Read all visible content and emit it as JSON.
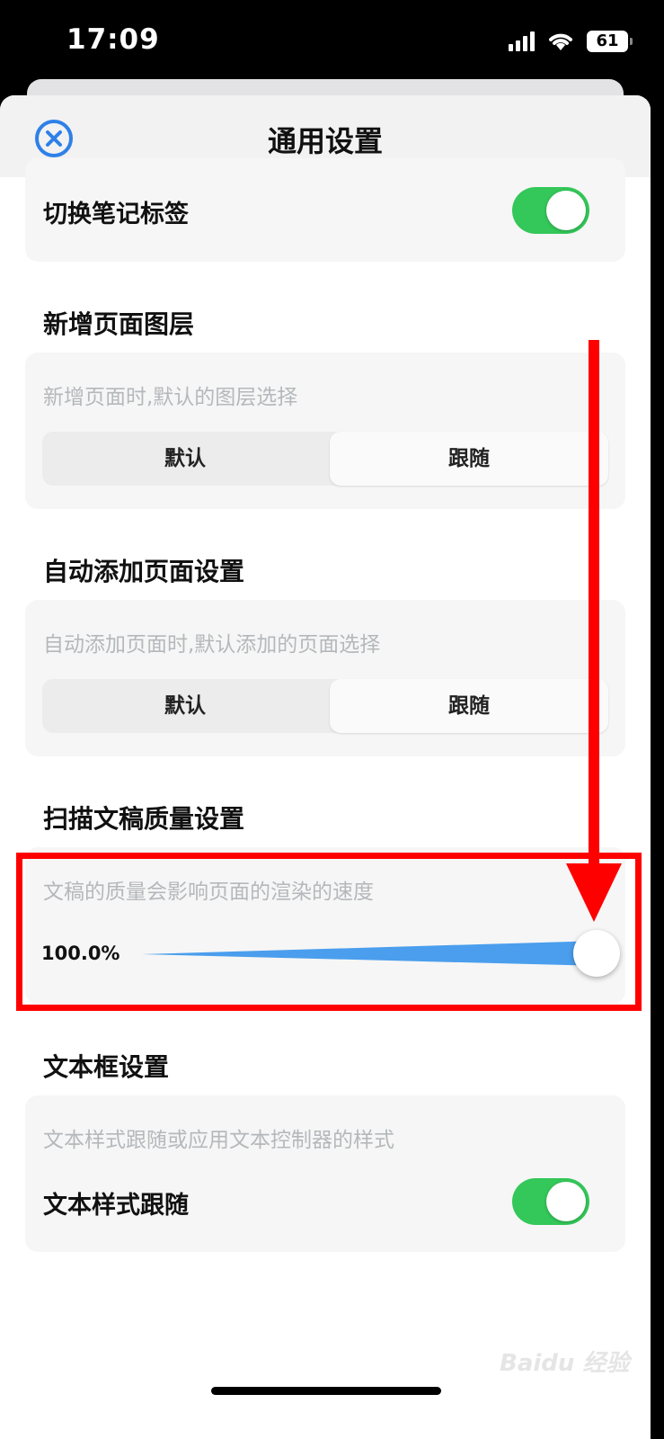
{
  "status_bar": {
    "time": "17:09",
    "battery": "61",
    "icons": [
      "signal-icon",
      "wifi-icon",
      "battery-icon"
    ]
  },
  "navbar": {
    "title": "通用设置",
    "close_icon": "close-circle-icon"
  },
  "colors": {
    "accent_blue": "#2f80e8",
    "toggle_green": "#34c759",
    "annotation_red": "#ff0000"
  },
  "sections": {
    "switch_note_tags": {
      "label": "切换笔记标签",
      "enabled": true
    },
    "new_page_layer": {
      "title": "新增页面图层",
      "hint": "新增页面时,默认的图层选择",
      "options": [
        "默认",
        "跟随"
      ],
      "selected": "跟随"
    },
    "auto_add_page": {
      "title": "自动添加页面设置",
      "hint": "自动添加页面时,默认添加的页面选择",
      "options": [
        "默认",
        "跟随"
      ],
      "selected": "跟随"
    },
    "scan_quality": {
      "title": "扫描文稿质量设置",
      "hint": "文稿的质量会影响页面的渲染的速度",
      "value_text": "100.0%",
      "value": 1.0
    },
    "textbox": {
      "title": "文本框设置",
      "hint": "文本样式跟随或应用文本控制器的样式",
      "label": "文本样式跟随",
      "enabled": true
    }
  },
  "watermark": "Baidu 经验"
}
